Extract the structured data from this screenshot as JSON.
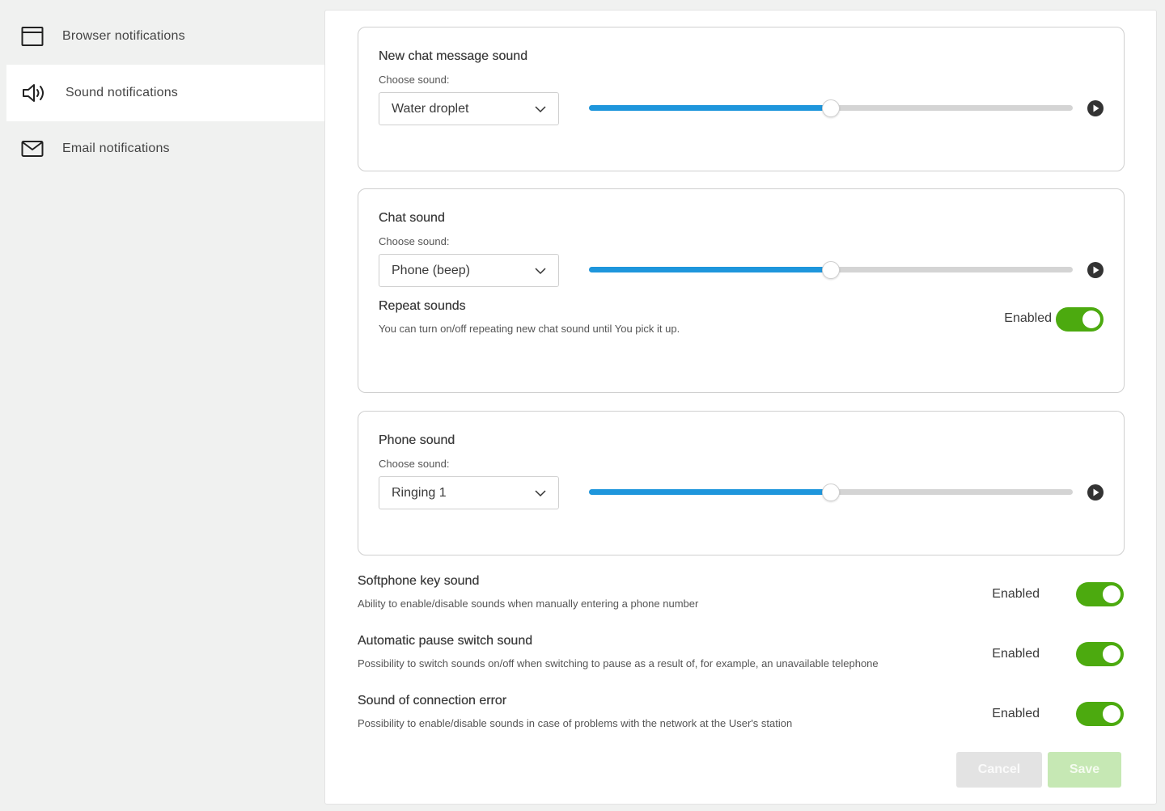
{
  "sidebar": {
    "items": [
      {
        "label": "Browser notifications",
        "icon": "browser-window-icon"
      },
      {
        "label": "Sound notifications",
        "icon": "speaker-icon",
        "active": true
      },
      {
        "label": "Email notifications",
        "icon": "envelope-icon"
      }
    ]
  },
  "cards": [
    {
      "title": "New chat message sound",
      "choose_label": "Choose sound:",
      "selected": "Water droplet",
      "volume_percent": 50
    },
    {
      "title": "Chat sound",
      "choose_label": "Choose sound:",
      "selected": "Phone (beep)",
      "volume_percent": 50,
      "repeat": {
        "title": "Repeat sounds",
        "description": "You can turn on/off repeating new chat sound until You pick it up.",
        "status": "Enabled",
        "enabled": true
      }
    },
    {
      "title": "Phone sound",
      "choose_label": "Choose sound:",
      "selected": "Ringing 1",
      "volume_percent": 50
    }
  ],
  "options": [
    {
      "title": "Softphone key sound",
      "description": "Ability to enable/disable sounds when manually entering a phone number",
      "status": "Enabled",
      "enabled": true
    },
    {
      "title": "Automatic pause switch sound",
      "description": "Possibility to switch sounds on/off when switching to pause as a result of, for example, an unavailable telephone",
      "status": "Enabled",
      "enabled": true
    },
    {
      "title": "Sound of connection error",
      "description": "Possibility to enable/disable sounds in case of problems with the network at the User's station",
      "status": "Enabled",
      "enabled": true
    }
  ],
  "buttons": {
    "cancel": "Cancel",
    "save": "Save"
  },
  "colors": {
    "accent_blue": "#1e96dc",
    "toggle_green": "#4caa0f",
    "save_disabled": "#c6e8b4",
    "cancel_disabled": "#e3e3e3"
  }
}
